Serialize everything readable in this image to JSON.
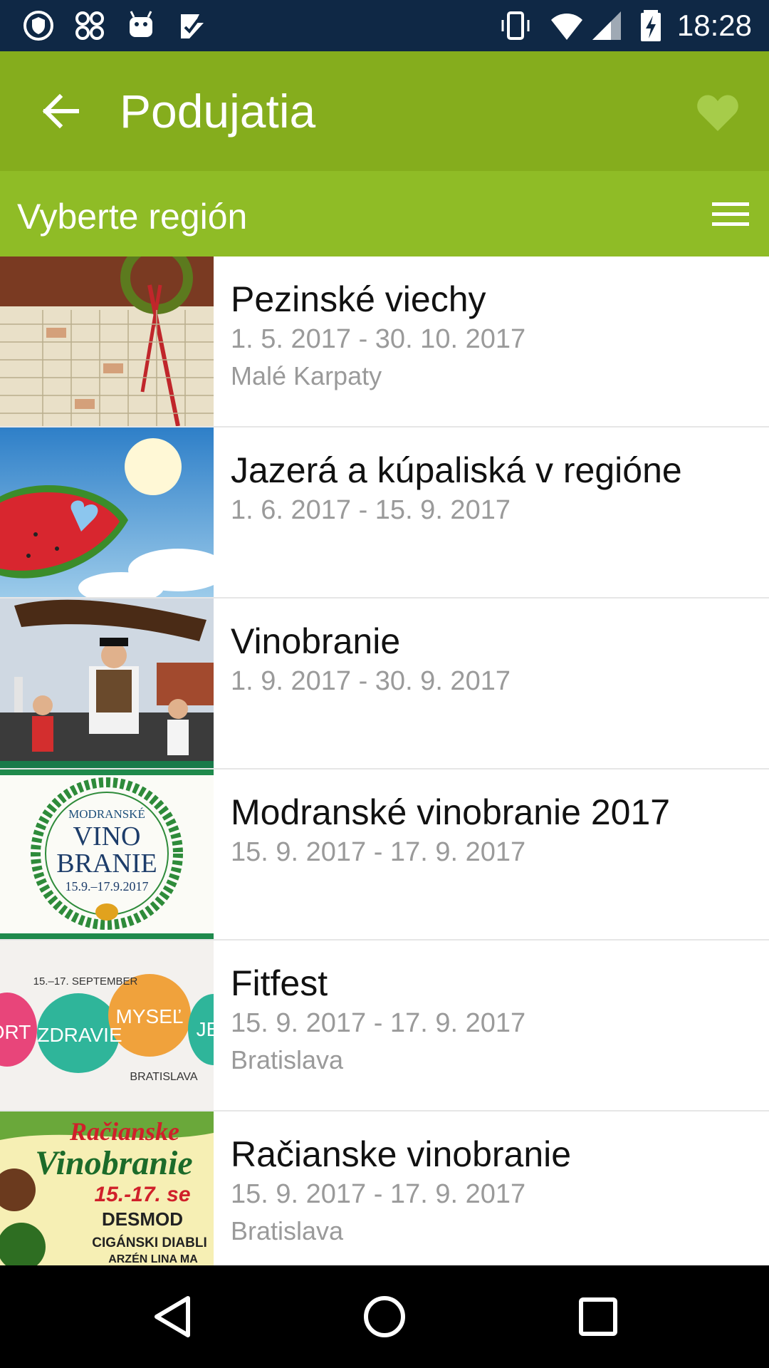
{
  "status_bar": {
    "time": "18:28",
    "left_icons": [
      "shield-icon",
      "pinwheel-icon",
      "android-icon",
      "task-check-icon"
    ],
    "right_icons": [
      "vibrate-icon",
      "wifi-icon",
      "signal-icon",
      "battery-charging-icon"
    ]
  },
  "app_bar": {
    "title": "Podujatia",
    "back_icon": "arrow-left-icon",
    "favorite_icon": "heart-icon"
  },
  "region_bar": {
    "label": "Vyberte región",
    "menu_icon": "hamburger-icon"
  },
  "events": [
    {
      "name": "Pezinské viechy",
      "date": "1. 5. 2017 - 30. 10. 2017",
      "place": "Malé Karpaty"
    },
    {
      "name": "Jazerá a kúpaliská v regióne",
      "date": "1. 6. 2017 - 15. 9. 2017",
      "place": ""
    },
    {
      "name": "Vinobranie",
      "date": "1. 9. 2017 - 30. 9. 2017",
      "place": ""
    },
    {
      "name": "Modranské vinobranie 2017",
      "date": "15. 9. 2017 - 17. 9. 2017",
      "place": ""
    },
    {
      "name": "Fitfest",
      "date": "15. 9. 2017 - 17. 9. 2017",
      "place": "Bratislava"
    },
    {
      "name": "Račianske vinobranie",
      "date": "15. 9. 2017 - 17. 9. 2017",
      "place": "Bratislava"
    }
  ],
  "thumb_text": {
    "modra_line1": "MODRANSKÉ",
    "modra_line2": "VINO",
    "modra_line3": "BRANIE",
    "modra_line4": "15.9.–17.9.2017",
    "fit_date": "15.–17. SEPTEMBER",
    "fit_word1": "ORT",
    "fit_word2": "ZDRAVIE",
    "fit_word3": "MYSEĽ",
    "fit_word4": "JE",
    "fit_city": "BRATISLAVA",
    "raca_line1": "Račianske",
    "raca_line2": "Vinobranie",
    "raca_line3": "15.-17. se",
    "raca_line4": "DESMOD",
    "raca_line5": "CIGÁNSKI DIABLI",
    "raca_line6": "ARZÉN   LINA MA"
  },
  "nav_bar": {
    "back_icon": "nav-back-triangle-icon",
    "home_icon": "nav-home-circle-icon",
    "recents_icon": "nav-recents-square-icon"
  },
  "colors": {
    "status_bar": "#0f2845",
    "app_bar": "#85ad1d",
    "region_bar": "#8fbc26",
    "title_text": "#111111",
    "secondary_text": "#9a9a9a",
    "heart": "#a6cc4a"
  }
}
